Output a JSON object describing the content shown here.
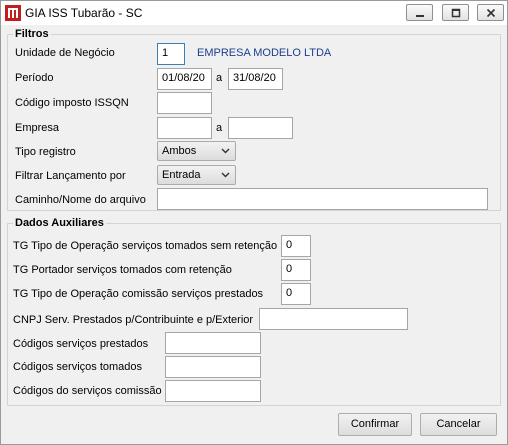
{
  "window": {
    "title": "GIA ISS Tubarão - SC"
  },
  "filtros": {
    "group_title": "Filtros",
    "unidade": {
      "label": "Unidade de Negócio",
      "value": "1",
      "name": "EMPRESA MODELO LTDA"
    },
    "periodo": {
      "label": "Período",
      "from": "01/08/20",
      "sep": "a",
      "to": "31/08/20"
    },
    "codigo_imposto": {
      "label": "Código imposto ISSQN",
      "value": ""
    },
    "empresa": {
      "label": "Empresa",
      "from": "",
      "sep": "a",
      "to": ""
    },
    "tipo_registro": {
      "label": "Tipo registro",
      "value": "Ambos"
    },
    "filtrar": {
      "label": "Filtrar Lançamento por",
      "value": "Entrada"
    },
    "caminho": {
      "label": "Caminho/Nome do arquivo",
      "value": ""
    }
  },
  "dados": {
    "group_title": "Dados Auxiliares",
    "tg_tomados_sem": {
      "label": "TG Tipo de Operação serviços tomados sem retenção",
      "value": "0"
    },
    "tg_portador": {
      "label": "TG Portador serviços tomados com retenção",
      "value": "0"
    },
    "tg_comissao": {
      "label": "TG Tipo de Operação comissão serviços prestados",
      "value": "0"
    },
    "cnpj": {
      "label": "CNPJ Serv. Prestados p/Contribuinte e p/Exterior",
      "value": ""
    },
    "cod_prestados": {
      "label": "Códigos serviços prestados",
      "value": ""
    },
    "cod_tomados": {
      "label": "Códigos serviços tomados",
      "value": ""
    },
    "cod_comissao": {
      "label": "Códigos do serviços comissão",
      "value": ""
    }
  },
  "buttons": {
    "confirm": "Confirmar",
    "cancel": "Cancelar"
  }
}
